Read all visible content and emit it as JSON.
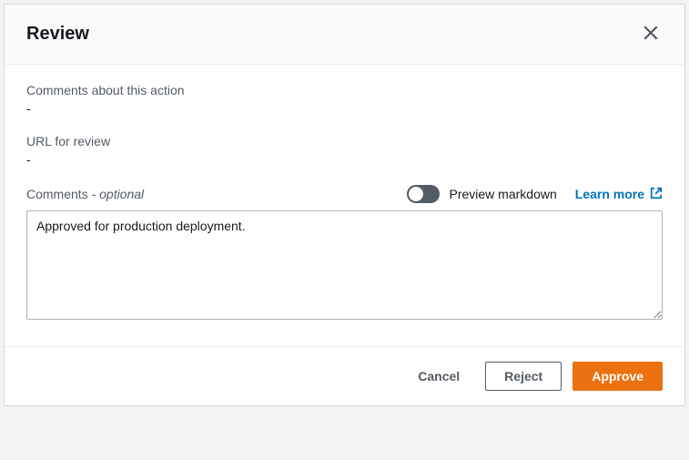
{
  "header": {
    "title": "Review"
  },
  "fields": {
    "comments_about_action": {
      "label": "Comments about this action",
      "value": "-"
    },
    "url_for_review": {
      "label": "URL for review",
      "value": "-"
    }
  },
  "comments": {
    "label": "Comments",
    "optional_hint": " - optional",
    "preview_toggle_label": "Preview markdown",
    "learn_more_label": "Learn more",
    "value": "Approved for production deployment."
  },
  "footer": {
    "cancel_label": "Cancel",
    "reject_label": "Reject",
    "approve_label": "Approve"
  }
}
